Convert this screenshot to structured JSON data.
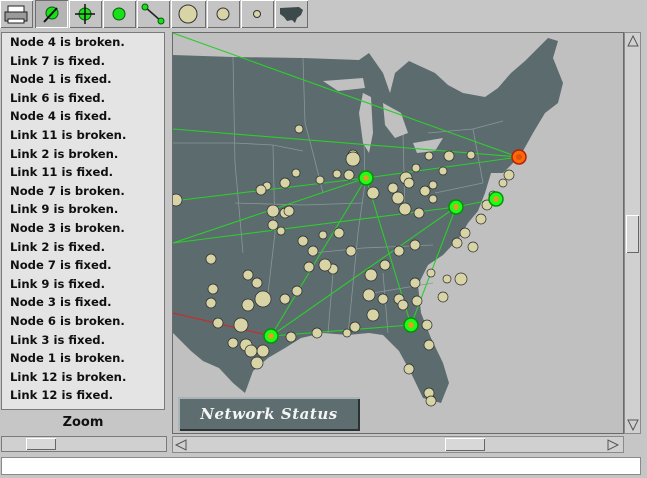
{
  "toolbar": {
    "buttons": [
      {
        "name": "printer-button",
        "icon": "printer-icon"
      },
      {
        "name": "probe-tool-button",
        "icon": "probe-icon"
      },
      {
        "name": "crosshair-tool-button",
        "icon": "crosshair-icon"
      },
      {
        "name": "add-node-button",
        "icon": "node-icon"
      },
      {
        "name": "add-link-button",
        "icon": "link-icon"
      },
      {
        "name": "large-node-button",
        "icon": "large-circle-icon"
      },
      {
        "name": "medium-node-button",
        "icon": "medium-circle-icon"
      },
      {
        "name": "small-node-button",
        "icon": "small-circle-icon"
      },
      {
        "name": "us-map-button",
        "icon": "us-map-icon"
      }
    ]
  },
  "log": {
    "lines": [
      "Node 4 is broken.",
      "Link 7 is fixed.",
      "Node 1 is fixed.",
      "Link 6 is fixed.",
      "Node 4 is fixed.",
      "Link 11 is broken.",
      "Link 2 is broken.",
      "Link 11 is fixed.",
      "Node 7 is broken.",
      "Link 9 is broken.",
      "Node 3 is broken.",
      "Link 2 is fixed.",
      "Node 7 is fixed.",
      "Link 9 is fixed.",
      "Node 3 is fixed.",
      "Node 6 is broken.",
      "Link 3 is fixed.",
      "Node 1 is broken.",
      "Link 12 is broken.",
      "Link 12 is fixed."
    ]
  },
  "zoom_label": "Zoom",
  "map": {
    "status_button": "Network Status"
  },
  "colors": {
    "land": "#5b6b6e",
    "sea": "#c0c0c0",
    "link_ok": "#2ecc2e",
    "link_broken": "#d02828",
    "node_ok": "#19ff19",
    "node_broken": "#ff6a00",
    "city": "#d9d4a6"
  },
  "status_bar": ""
}
